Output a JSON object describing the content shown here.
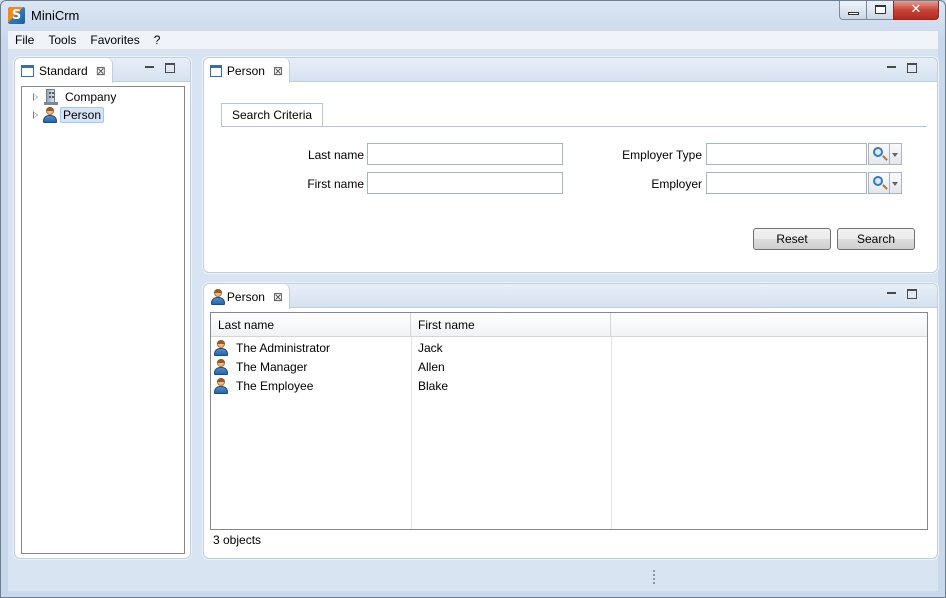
{
  "window": {
    "app_icon_letter": "S",
    "title": "MiniCrm",
    "controls": {
      "minimize": "_",
      "maximize": "□",
      "close": "✕"
    }
  },
  "menu": [
    "File",
    "Tools",
    "Favorites",
    "?"
  ],
  "outline": {
    "tab_label": "Standard",
    "close_glyph": "⊠",
    "tree": [
      {
        "label": "Company",
        "icon": "building-icon",
        "selected": false
      },
      {
        "label": "Person",
        "icon": "person-icon",
        "selected": true
      }
    ]
  },
  "search_view": {
    "tab_label": "Person",
    "close_glyph": "⊠",
    "group_tab": "Search Criteria",
    "fields": {
      "last_name": {
        "label": "Last name",
        "value": ""
      },
      "first_name": {
        "label": "First name",
        "value": ""
      },
      "employer_type": {
        "label": "Employer Type",
        "value": ""
      },
      "employer": {
        "label": "Employer",
        "value": ""
      }
    },
    "buttons": {
      "reset": "Reset",
      "search": "Search"
    }
  },
  "table_view": {
    "tab_label": "Person",
    "close_glyph": "⊠",
    "columns": [
      "Last name",
      "First name",
      ""
    ],
    "rows": [
      {
        "last_name": "The Administrator",
        "first_name": "Jack"
      },
      {
        "last_name": "The Manager",
        "first_name": "Allen"
      },
      {
        "last_name": "The Employee",
        "first_name": "Blake"
      }
    ],
    "status": "3 objects"
  },
  "colors": {
    "accent": "#3a6ea5",
    "selection": "#d5e5f7",
    "close_button": "#c8443a"
  }
}
